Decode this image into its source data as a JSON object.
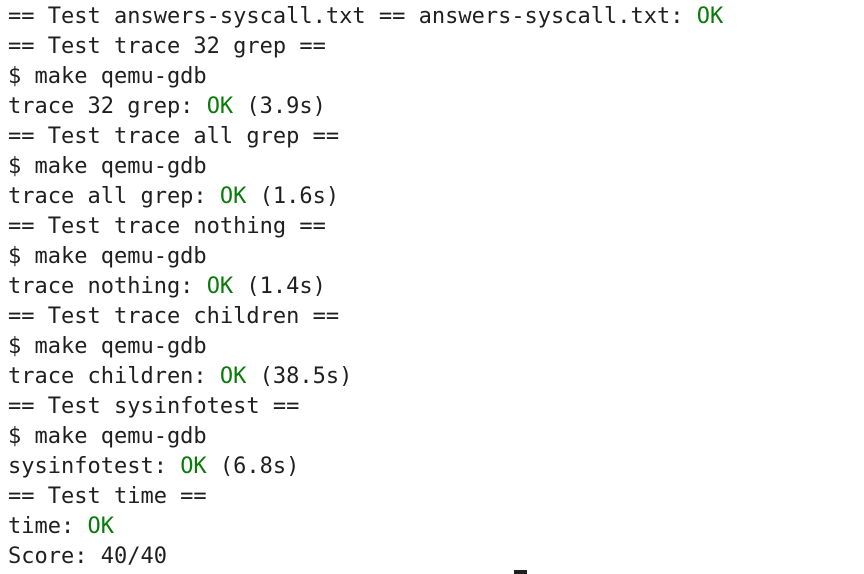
{
  "colors": {
    "background": "#ffffff",
    "text": "#1f1f1f",
    "ok": "#0a7a0a"
  },
  "terminal": {
    "lines": [
      {
        "prefix": "== Test answers-syscall.txt == answers-syscall.txt: ",
        "ok": "OK",
        "suffix": ""
      },
      {
        "prefix": "== Test trace 32 grep ==",
        "ok": "",
        "suffix": ""
      },
      {
        "prefix": "$ make qemu-gdb",
        "ok": "",
        "suffix": ""
      },
      {
        "prefix": "trace 32 grep: ",
        "ok": "OK",
        "suffix": " (3.9s)"
      },
      {
        "prefix": "== Test trace all grep ==",
        "ok": "",
        "suffix": ""
      },
      {
        "prefix": "$ make qemu-gdb",
        "ok": "",
        "suffix": ""
      },
      {
        "prefix": "trace all grep: ",
        "ok": "OK",
        "suffix": " (1.6s)"
      },
      {
        "prefix": "== Test trace nothing ==",
        "ok": "",
        "suffix": ""
      },
      {
        "prefix": "$ make qemu-gdb",
        "ok": "",
        "suffix": ""
      },
      {
        "prefix": "trace nothing: ",
        "ok": "OK",
        "suffix": " (1.4s)"
      },
      {
        "prefix": "== Test trace children ==",
        "ok": "",
        "suffix": ""
      },
      {
        "prefix": "$ make qemu-gdb",
        "ok": "",
        "suffix": ""
      },
      {
        "prefix": "trace children: ",
        "ok": "OK",
        "suffix": " (38.5s)"
      },
      {
        "prefix": "== Test sysinfotest ==",
        "ok": "",
        "suffix": ""
      },
      {
        "prefix": "$ make qemu-gdb",
        "ok": "",
        "suffix": ""
      },
      {
        "prefix": "sysinfotest: ",
        "ok": "OK",
        "suffix": " (6.8s)"
      },
      {
        "prefix": "== Test time ==",
        "ok": "",
        "suffix": ""
      },
      {
        "prefix": "time: ",
        "ok": "OK",
        "suffix": ""
      },
      {
        "prefix": "Score: 40/40",
        "ok": "",
        "suffix": ""
      }
    ]
  }
}
